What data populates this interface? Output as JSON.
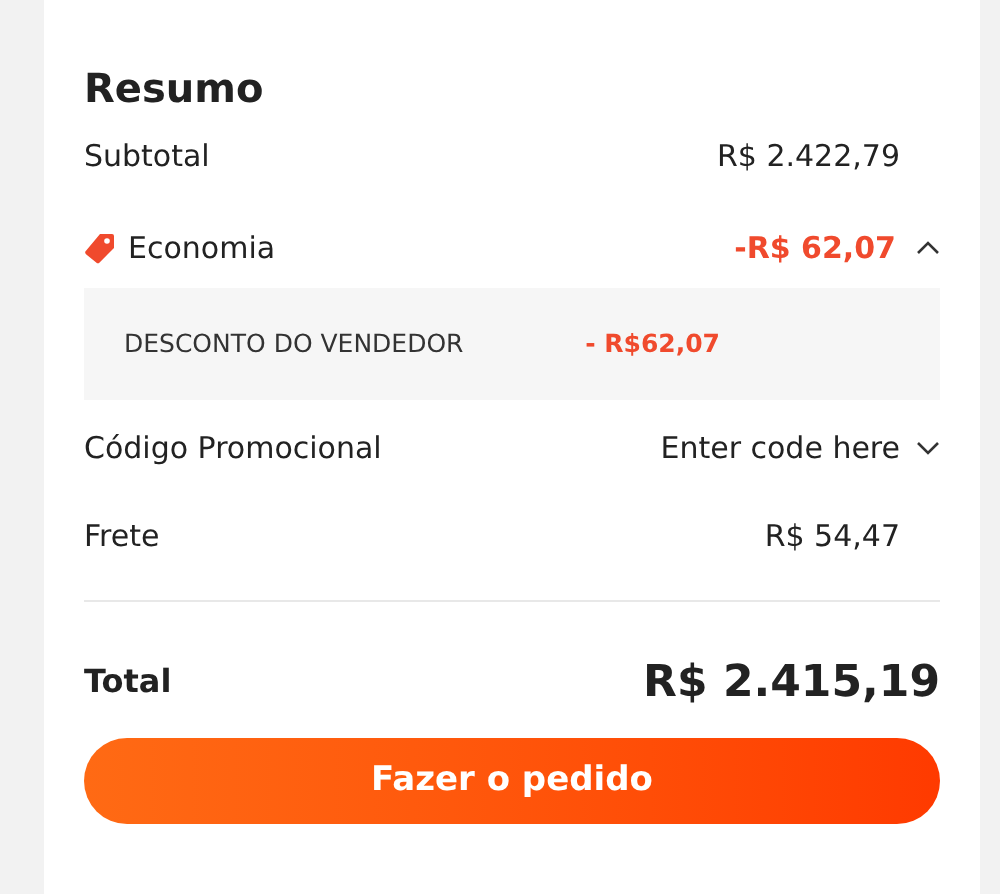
{
  "title": "Resumo",
  "subtotal": {
    "label": "Subtotal",
    "value": "R$ 2.422,79"
  },
  "savings": {
    "label": "Economia",
    "value": "-R$ 62,07",
    "expanded": true,
    "details": [
      {
        "label": "DESCONTO DO VENDEDOR",
        "value": "- R$62,07"
      }
    ]
  },
  "promo": {
    "label": "Código Promocional",
    "placeholder": "Enter code here"
  },
  "shipping": {
    "label": "Frete",
    "value": "R$ 54,47"
  },
  "total": {
    "label": "Total",
    "value": "R$ 2.415,19"
  },
  "button": "Fazer o pedido"
}
